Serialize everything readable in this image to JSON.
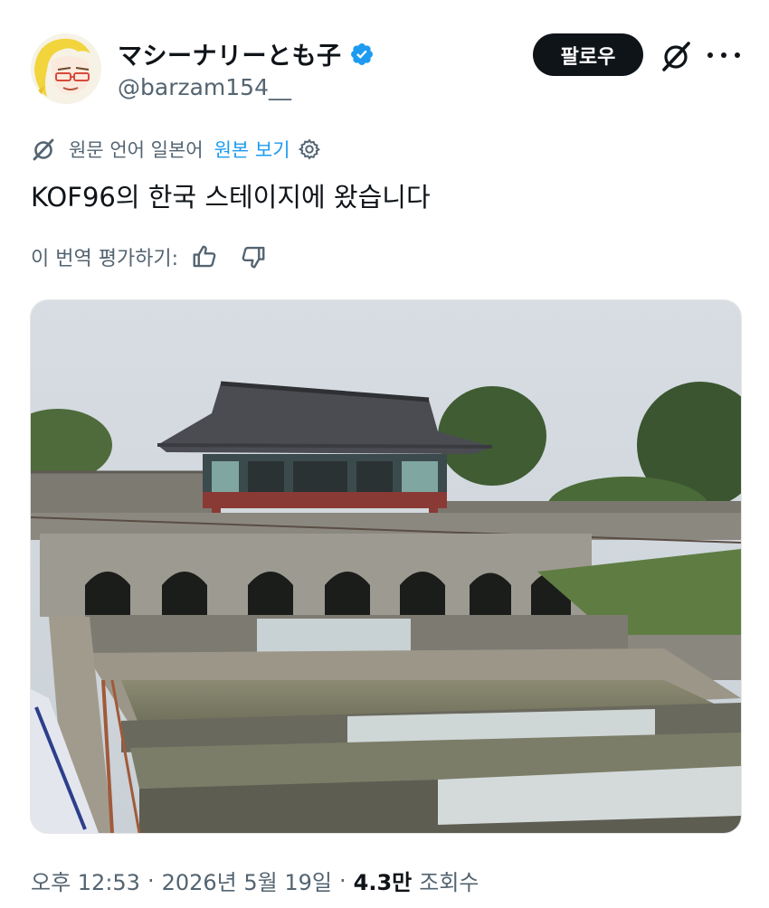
{
  "author": {
    "display_name": "マシーナリーとも子",
    "handle": "@barzam154__",
    "verified": true
  },
  "actions": {
    "follow_label": "팔로우"
  },
  "translation": {
    "source_label": "원문 언어 일본어",
    "show_original": "원본 보기",
    "rate_label": "이 번역 평가하기:"
  },
  "tweet": {
    "text": "KOF96의 한국 스테이지에 왔습니다"
  },
  "meta": {
    "time": "오후 12:53",
    "date": "2026년 5월 19일",
    "views_count": "4.3만",
    "views_label": "조회수"
  },
  "colors": {
    "accent": "#1d9bf0",
    "text_primary": "#0f1419",
    "text_secondary": "#536471",
    "follow_bg": "#0f1419"
  },
  "icons": {
    "verified": "verified-badge-icon",
    "grok": "grok-icon",
    "more": "more-icon",
    "translate": "translate-icon",
    "settings": "gear-icon",
    "thumbs_up": "thumbs-up-icon",
    "thumbs_down": "thumbs-down-icon"
  }
}
